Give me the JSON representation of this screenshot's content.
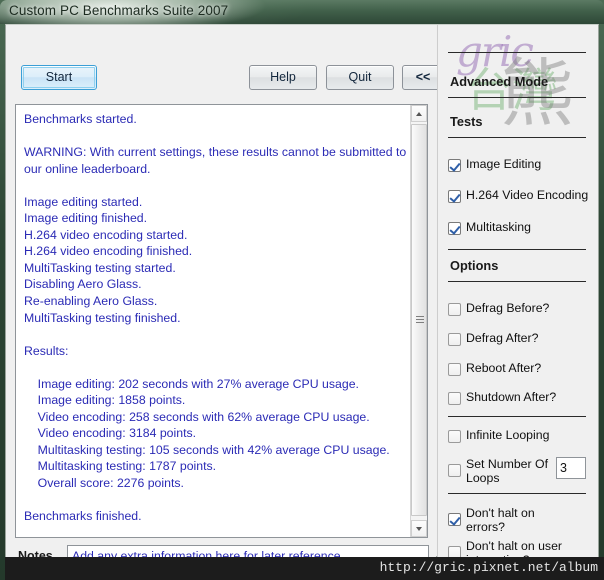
{
  "window": {
    "title": "Custom PC Benchmarks Suite 2007"
  },
  "toolbar": {
    "start_label": "Start",
    "help_label": "Help",
    "quit_label": "Quit",
    "collapse_label": "<<"
  },
  "log": {
    "text": "Benchmarks started.\n\nWARNING: With current settings, these results cannot be submitted to our online leaderboard.\n\nImage editing started.\nImage editing finished.\nH.264 video encoding started.\nH.264 video encoding finished.\nMultiTasking testing started.\nDisabling Aero Glass.\nRe-enabling Aero Glass.\nMultiTasking testing finished.\n\nResults:\n\n    Image editing: 202 seconds with 27% average CPU usage.\n    Image editing: 1858 points.\n    Video encoding: 258 seconds with 62% average CPU usage.\n    Video encoding: 3184 points.\n    Multitasking testing: 105 seconds with 42% average CPU usage.\n    Multitasking testing: 1787 points.\n    Overall score: 2276 points.\n\nBenchmarks finished.",
    "accent_color": "#2b2bb5"
  },
  "notes": {
    "label": "Notes",
    "value": "",
    "placeholder": "Add any extra information here for later reference."
  },
  "sidebar": {
    "advanced_mode_label": "Advanced Mode",
    "tests_label": "Tests",
    "options_label": "Options",
    "tests": [
      {
        "label": "Image Editing",
        "checked": true
      },
      {
        "label": "H.264 Video Encoding",
        "checked": true
      },
      {
        "label": "Multitasking",
        "checked": true
      }
    ],
    "options": [
      {
        "label": "Defrag Before?",
        "checked": false
      },
      {
        "label": "Defrag After?",
        "checked": false
      },
      {
        "label": "Reboot After?",
        "checked": false
      },
      {
        "label": "Shutdown After?",
        "checked": false
      }
    ],
    "looping": [
      {
        "label": "Infinite Looping",
        "checked": false
      },
      {
        "label": "Set Number Of Loops",
        "checked": false
      }
    ],
    "loops_value": "3",
    "halting": [
      {
        "label": "Don't halt on errors?",
        "checked": true
      },
      {
        "label": "Don't halt on user interaction?",
        "checked": false
      }
    ],
    "watermark": {
      "brand": "gric",
      "cn_green": "台灣",
      "cn_gray": "熊"
    }
  },
  "footer": {
    "url": "http://gric.pixnet.net/album"
  }
}
